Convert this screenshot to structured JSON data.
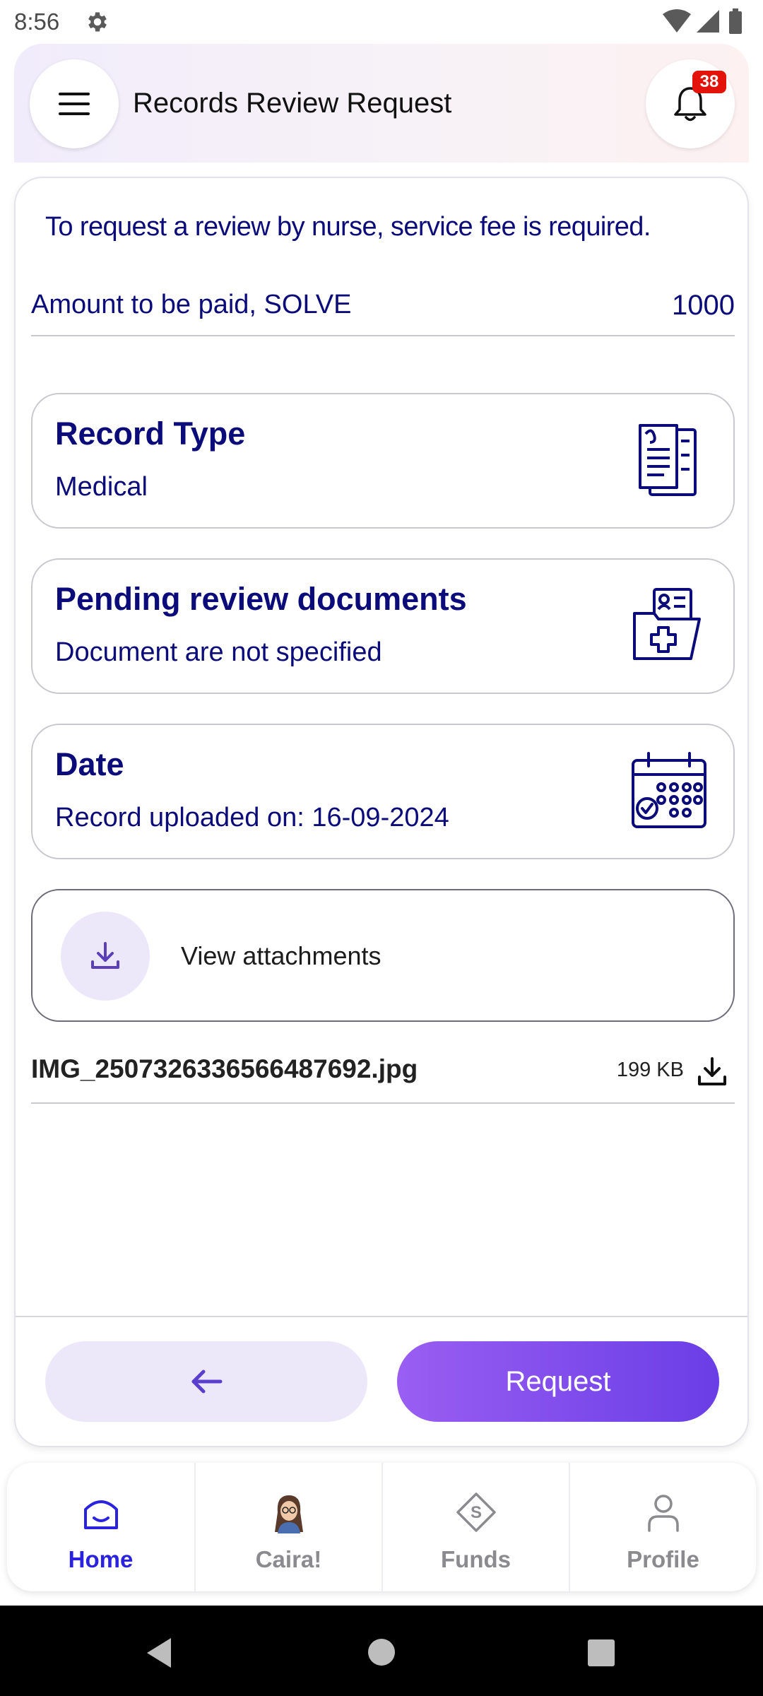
{
  "status_bar": {
    "time": "8:56",
    "icons": [
      "gear-icon",
      "wifi-icon",
      "signal-icon",
      "battery-icon"
    ]
  },
  "header": {
    "title": "Records Review Request",
    "menu_icon": "hamburger-menu-icon",
    "notification_icon": "bell-icon",
    "notification_count": "38"
  },
  "main": {
    "notice": "To request a review by nurse, service fee is required.",
    "amount_label": "Amount to be paid, SOLVE",
    "amount_value": "1000",
    "cards": [
      {
        "title": "Record Type",
        "subtitle": "Medical",
        "icon": "clipboard-document-icon"
      },
      {
        "title": "Pending review documents",
        "subtitle": "Document are not specified",
        "icon": "medical-folder-icon"
      },
      {
        "title": "Date",
        "subtitle": "Record uploaded on: 16-09-2024",
        "icon": "calendar-check-icon"
      }
    ],
    "attachments_label": "View attachments",
    "attachments_icon": "download-icon",
    "file": {
      "name": "IMG_2507326336566487692.jpg",
      "size": "199 KB",
      "icon": "download-icon"
    }
  },
  "actions": {
    "back_icon": "arrow-left-icon",
    "request_label": "Request"
  },
  "bottom_nav": [
    {
      "label": "Home",
      "icon": "home-icon",
      "active": true
    },
    {
      "label": "Caira!",
      "icon": "avatar-icon",
      "active": false
    },
    {
      "label": "Funds",
      "icon": "funds-diamond-icon",
      "active": false
    },
    {
      "label": "Profile",
      "icon": "profile-icon",
      "active": false
    }
  ],
  "colors": {
    "primary_text": "#0b0b7a",
    "accent": "#6a3ee6",
    "nav_active": "#2b22e0",
    "badge": "#e3120b"
  }
}
